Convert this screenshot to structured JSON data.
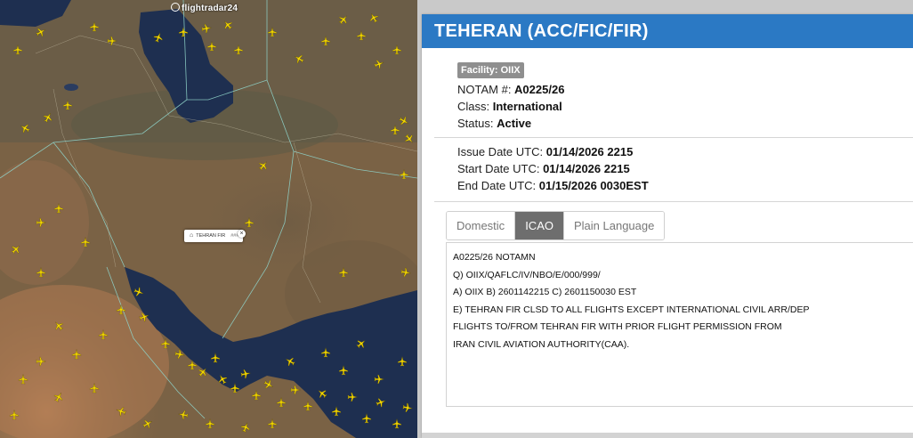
{
  "map": {
    "logo": "flightradar24",
    "fir_label": "TEHRAN FIR",
    "fir_count": "###",
    "fir_close": "×",
    "colors": {
      "land": "#7a6245",
      "water": "#1e2f50",
      "aircraft": "#f2d600",
      "fir_boundary": "#8fd2c8"
    }
  },
  "panel": {
    "title": "TEHERAN (ACC/FIC/FIR)",
    "facility_badge": "Facility:  OIIX",
    "notam_label": "NOTAM #: ",
    "notam_value": "A0225/26",
    "class_label": "Class: ",
    "class_value": "International",
    "status_label": "Status: ",
    "status_value": "Active",
    "issue_label": "Issue Date UTC: ",
    "issue_value": "01/14/2026 2215",
    "start_label": "Start Date UTC: ",
    "start_value": "01/14/2026 2215",
    "end_label": "End Date UTC: ",
    "end_value": "01/15/2026 0030EST",
    "tabs": [
      {
        "label": "Domestic"
      },
      {
        "label": "ICAO"
      },
      {
        "label": "Plain Language"
      }
    ],
    "active_tab": "ICAO",
    "notam_text": [
      "A0225/26 NOTAMN",
      "Q) OIIX/QAFLC/IV/NBO/E/000/999/",
      "A) OIIX B) 2601142215 C) 2601150030 EST",
      "E) TEHRAN FIR CLSD TO ALL FLIGHTS EXCEPT INTERNATIONAL CIVIL ARR/DEP",
      "FLIGHTS TO/FROM TEHRAN FIR WITH PRIOR FLIGHT PERMISSION FROM",
      "IRAN CIVIL AVIATION AUTHORITY(CAA)."
    ],
    "colors": {
      "header": "#2b79c4",
      "badge": "#8f8f8f",
      "active_tab": "#6e6e6e"
    }
  }
}
